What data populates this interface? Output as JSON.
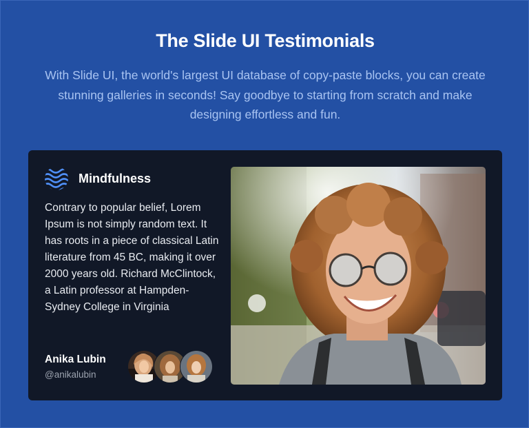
{
  "header": {
    "title": "The Slide UI Testimonials",
    "subtitle": "With Slide UI, the world's largest UI database of copy-paste blocks, you can create stunning galleries in seconds! Say goodbye to starting from scratch and make designing effortless and fun."
  },
  "testimonial": {
    "brand_icon": "wave-logo-icon",
    "brand_name": "Mindfulness",
    "quote": "Contrary to popular belief, Lorem Ipsum is not simply random text. It has roots in a piece of classical Latin literature from 45 BC, making it over 2000 years old. Richard McClintock, a Latin professor at Hampden-Sydney College in Virginia",
    "author_name": "Anika Lubin",
    "author_handle": "@anikalubin",
    "avatar_count": 3,
    "photo": "smiling-woman-photo"
  },
  "colors": {
    "background": "#2350a4",
    "card": "#111827",
    "accent": "#4f8ff7",
    "subtitle": "#a9c4f2"
  }
}
